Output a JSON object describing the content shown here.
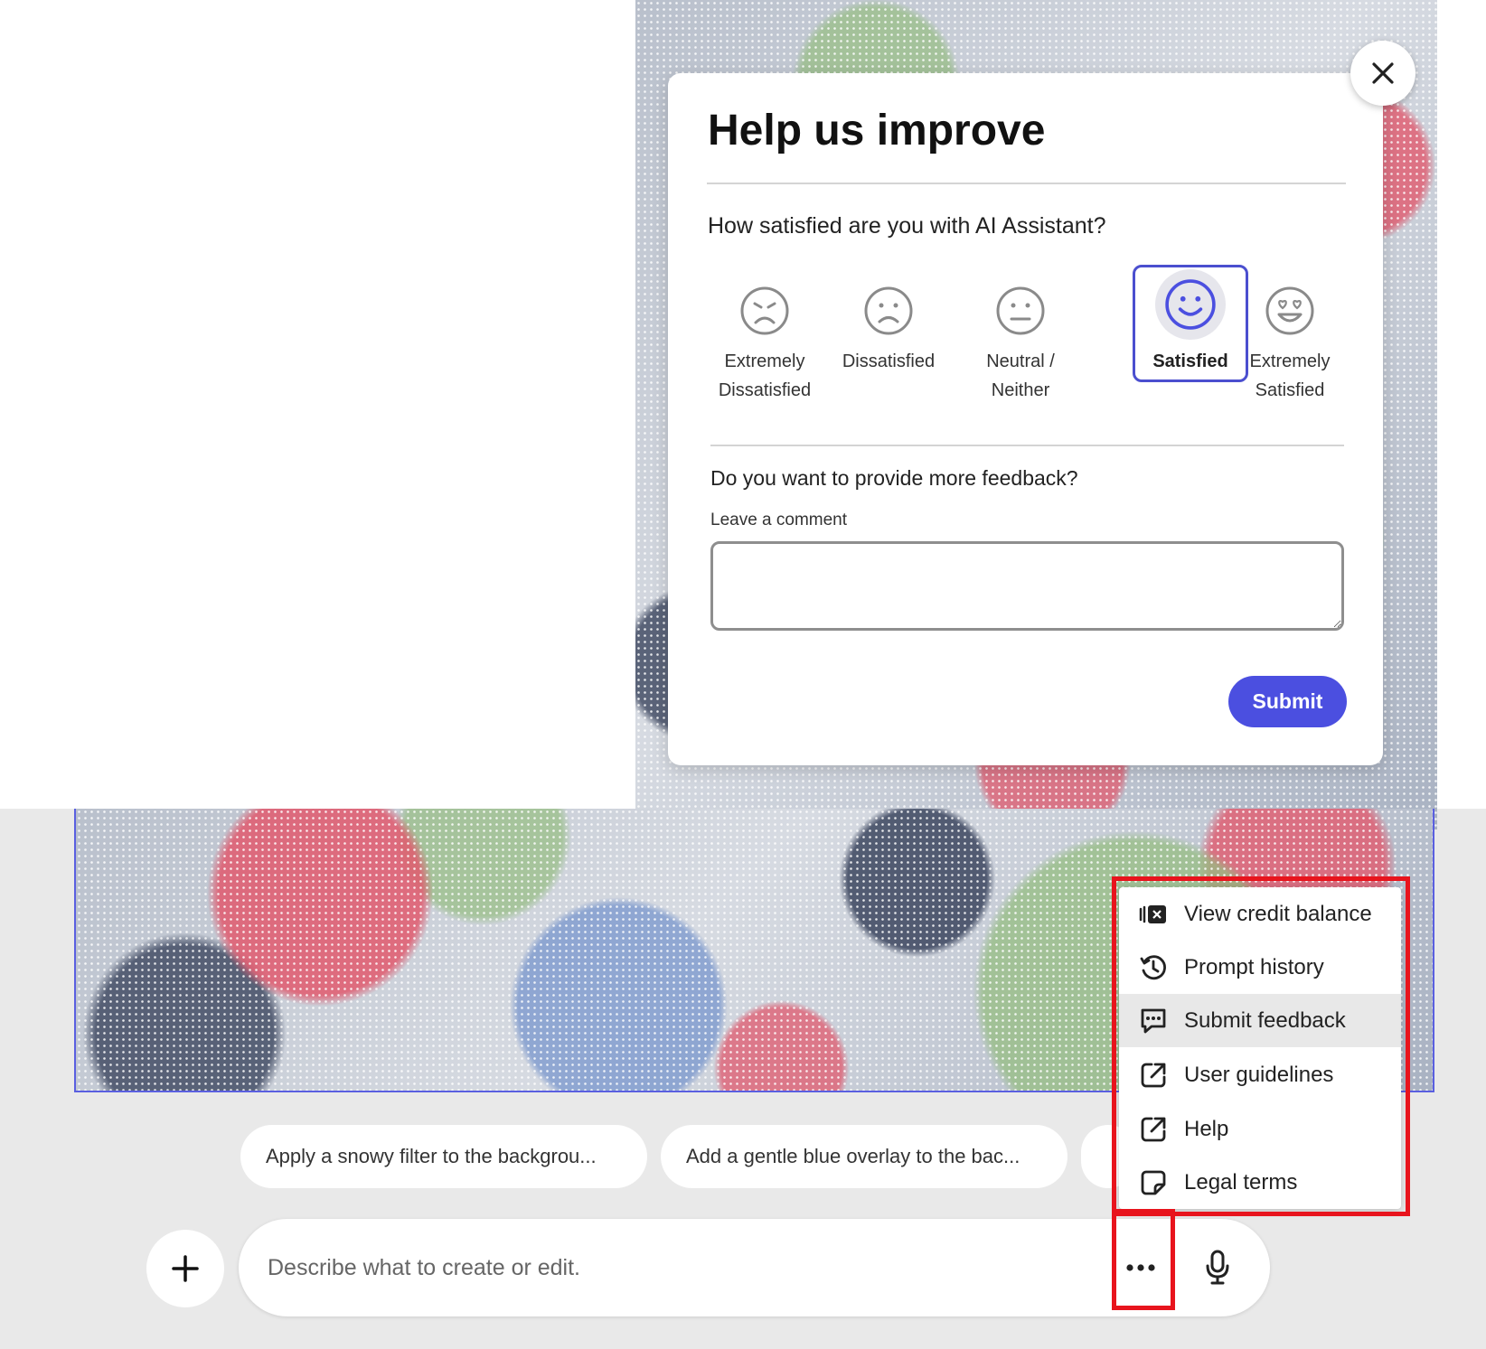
{
  "dialog": {
    "title": "Help us improve",
    "question": "How satisfied are you with AI Assistant?",
    "ratings": [
      {
        "label_line1": "Extremely",
        "label_line2": "Dissatisfied"
      },
      {
        "label_line1": "Dissatisfied",
        "label_line2": ""
      },
      {
        "label_line1": "Neutral /",
        "label_line2": "Neither"
      },
      {
        "label_line1": "Satisfied",
        "label_line2": ""
      },
      {
        "label_line1": "Extremely",
        "label_line2": "Satisfied"
      }
    ],
    "selected_rating": "Satisfied",
    "more_feedback_question": "Do you want to provide more feedback?",
    "comment_label": "Leave a comment",
    "comment_value": "",
    "submit_label": "Submit",
    "accent_color": "#4b4fe0"
  },
  "suggestions": [
    "Apply a snowy filter to the backgrou...",
    "Add a gentle blue overlay to the bac..."
  ],
  "prompt": {
    "placeholder": "Describe what to create or edit."
  },
  "menu": {
    "items": [
      {
        "label": "View credit balance",
        "icon": "credit-balance-icon"
      },
      {
        "label": "Prompt history",
        "icon": "history-icon"
      },
      {
        "label": "Submit feedback",
        "icon": "feedback-icon"
      },
      {
        "label": "User guidelines",
        "icon": "external-link-icon"
      },
      {
        "label": "Help",
        "icon": "external-link-icon"
      },
      {
        "label": "Legal terms",
        "icon": "document-icon"
      }
    ],
    "active_item": "Submit feedback"
  },
  "annotation_color": "#e8141d"
}
